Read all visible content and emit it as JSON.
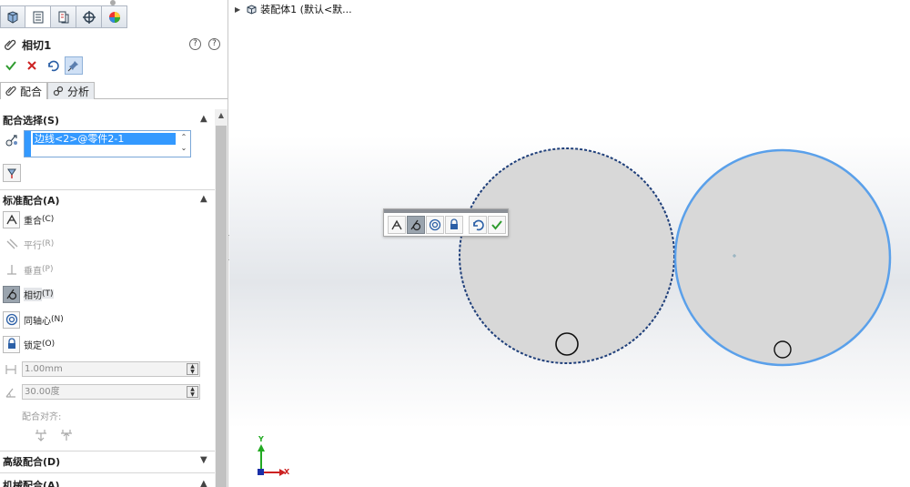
{
  "property_manager": {
    "tabs": [
      {
        "icon": "feature-manager-icon"
      },
      {
        "icon": "property-manager-icon"
      },
      {
        "icon": "configuration-manager-icon"
      },
      {
        "icon": "dimxpert-icon"
      },
      {
        "icon": "display-manager-icon"
      }
    ],
    "title": "相切1",
    "help_labels": [
      "?",
      "?"
    ],
    "actions": [
      {
        "icon": "ok-checkmark-icon",
        "color": "#2e9b2e"
      },
      {
        "icon": "cancel-x-icon",
        "color": "#cc2222"
      },
      {
        "icon": "undo-icon"
      },
      {
        "icon": "pushpin-icon"
      }
    ],
    "subtabs": [
      {
        "label": "配合",
        "active": true
      },
      {
        "label": "分析",
        "active": false
      }
    ],
    "mate_selection": {
      "header": "配合选择(S)",
      "selected_item": "边线<2>@零件2-1"
    },
    "standard_mates": {
      "header": "标准配合(A)",
      "items": [
        {
          "label": "重合",
          "key": "(C)",
          "enabled": true,
          "selected": false
        },
        {
          "label": "平行",
          "key": "(R)",
          "enabled": false,
          "selected": false
        },
        {
          "label": "垂直",
          "key": "(P)",
          "enabled": false,
          "selected": false
        },
        {
          "label": "相切",
          "key": "(T)",
          "enabled": true,
          "selected": true
        },
        {
          "label": "同轴心",
          "key": "(N)",
          "enabled": true,
          "selected": false
        },
        {
          "label": "锁定",
          "key": "(O)",
          "enabled": true,
          "selected": false
        }
      ],
      "distance_value": "1.00mm",
      "angle_value": "30.00度",
      "alignment_label": "配合对齐:"
    },
    "advanced_mates_header": "高级配合(D)",
    "mechanical_mates_header": "机械配合(A)"
  },
  "graphics": {
    "tree_label": "装配体1 (默认<默...",
    "triad": {
      "x_label": "X",
      "y_label": "Y",
      "x_color": "#cc2222",
      "y_color": "#22aa22",
      "origin_color": "#1a2fa8"
    },
    "selection_color": "#4a90e2",
    "part_fill": "#d8d8d8"
  },
  "context_toolbar": {
    "buttons": [
      "coincident-icon",
      "tangent-icon",
      "concentric-icon",
      "lock-icon",
      "undo-icon",
      "ok-checkmark-icon"
    ],
    "active": "tangent-icon"
  }
}
